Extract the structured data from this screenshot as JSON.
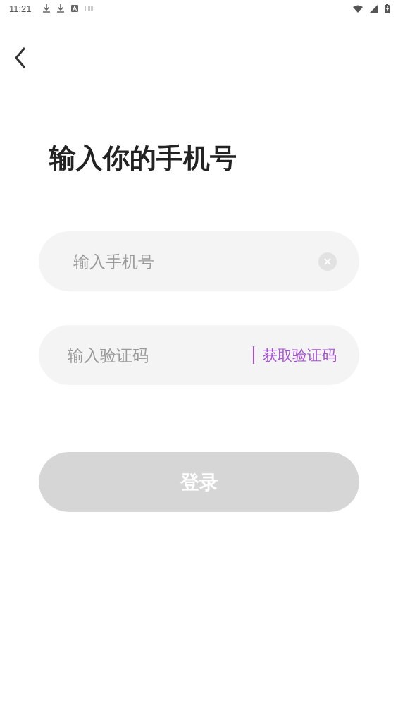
{
  "status_bar": {
    "time": "11:21"
  },
  "title": "输入你的手机号",
  "phone_field": {
    "placeholder": "输入手机号"
  },
  "code_field": {
    "placeholder": "输入验证码",
    "action": "获取验证码"
  },
  "login_button": {
    "label": "登录",
    "disabled": true
  }
}
